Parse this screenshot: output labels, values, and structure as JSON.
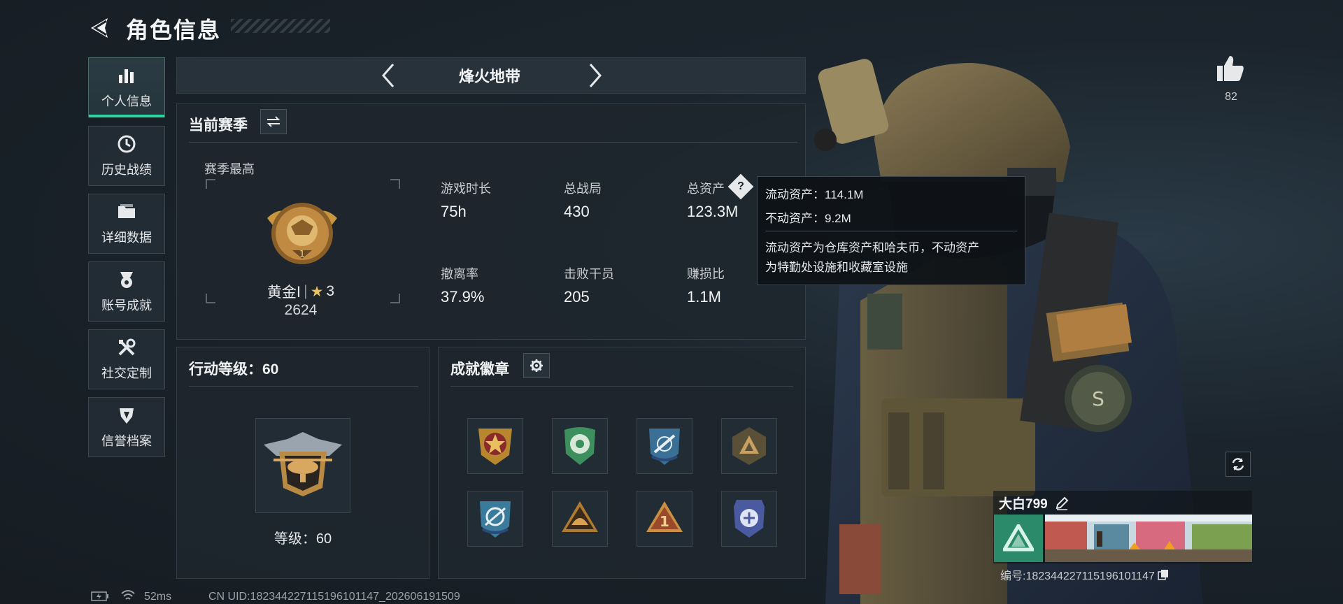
{
  "header": {
    "title": "角色信息"
  },
  "sidebar": {
    "items": [
      {
        "label": "个人信息",
        "icon": "bar-chart-icon"
      },
      {
        "label": "历史战绩",
        "icon": "clock-icon"
      },
      {
        "label": "详细数据",
        "icon": "folder-icon"
      },
      {
        "label": "账号成就",
        "icon": "medal-icon"
      },
      {
        "label": "社交定制",
        "icon": "tools-icon"
      },
      {
        "label": "信誉档案",
        "icon": "shield-icon"
      }
    ]
  },
  "mode": {
    "label": "烽火地带"
  },
  "season": {
    "title": "当前赛季",
    "best_label": "赛季最高",
    "rank_name": "黄金Ⅰ",
    "rank_stars": "3",
    "rank_score": "2624",
    "rank_emblem_number": "1",
    "stats": [
      {
        "label": "游戏时长",
        "value": "75h"
      },
      {
        "label": "总战局",
        "value": "430"
      },
      {
        "label": "总资产",
        "value": "123.3M"
      },
      {
        "label": "撤离率",
        "value": "37.9%"
      },
      {
        "label": "击败干员",
        "value": "205"
      },
      {
        "label": "赚损比",
        "value": "1.1M"
      }
    ]
  },
  "tooltip": {
    "line1": "流动资产：114.1M",
    "line2": "不动资产：9.2M",
    "desc1": "流动资产为仓库资产和哈夫币，不动资产",
    "desc2": "为特勤处设施和收藏室设施"
  },
  "action_level": {
    "title": "行动等级：60",
    "level_text": "等级：60"
  },
  "badges": {
    "title": "成就徽章",
    "items": [
      {
        "icon": "star-emblem-icon",
        "color": "#b8862e"
      },
      {
        "icon": "flower-emblem-icon",
        "color": "#3e8f5e"
      },
      {
        "icon": "rifle-emblem-icon",
        "color": "#3a6f96"
      },
      {
        "icon": "triangle-emblem-icon",
        "color": "#8a7a4e"
      },
      {
        "icon": "crosshair-emblem-icon",
        "color": "#3a7a9a"
      },
      {
        "icon": "helmet-emblem-icon",
        "color": "#b07a30"
      },
      {
        "icon": "number-one-emblem-icon",
        "color": "#9a4a2a"
      },
      {
        "icon": "eagle-emblem-icon",
        "color": "#4a5aa0"
      }
    ]
  },
  "profile": {
    "like_count": "82",
    "player_name": "大白799",
    "player_id": "编号:1823442271151961011​47"
  },
  "status_bar": {
    "ping": "52ms",
    "uid": "CN UID:1823442271151961011​47_202606191509"
  },
  "colors": {
    "accent": "#2fd3a0",
    "panel": "#1e262e"
  }
}
